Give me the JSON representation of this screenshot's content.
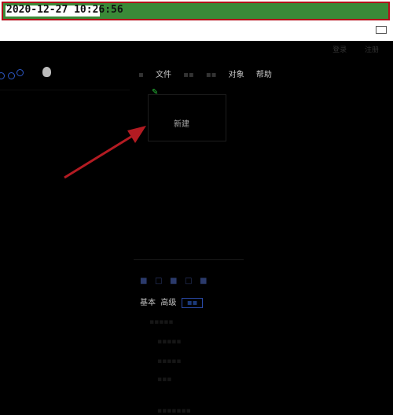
{
  "timestamp": "2020-12-27 10:26:56",
  "colors": {
    "frame": "#b30d1a",
    "highlight": "#3a8a38",
    "arrow": "#b31b22",
    "accent": "#29c23a"
  },
  "top_links": [
    "登录",
    "注册"
  ],
  "menu": {
    "items": [
      {
        "label": "文件",
        "dim": false
      },
      {
        "label": "对象",
        "dim": false
      },
      {
        "label": "帮助",
        "dim": false
      }
    ]
  },
  "dropdown": {
    "item": "新建"
  },
  "toolbar": {
    "tab1": "基本",
    "tab2": "高级"
  }
}
